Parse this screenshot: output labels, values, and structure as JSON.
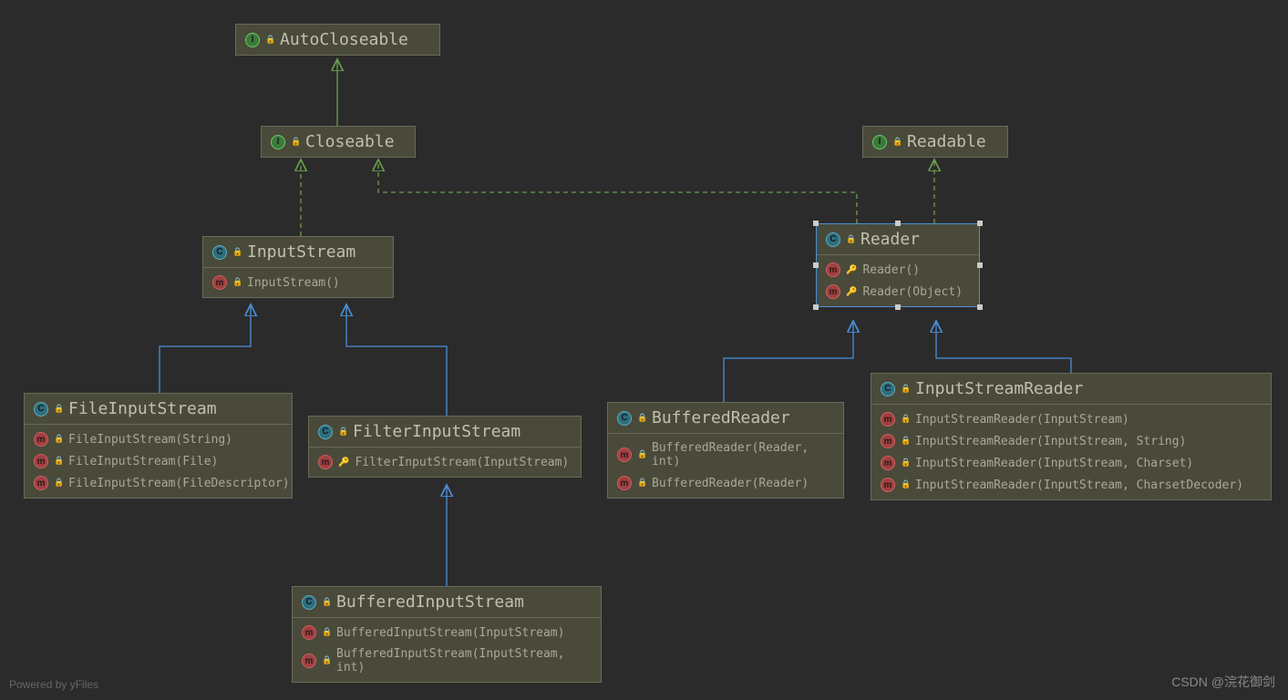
{
  "nodes": {
    "autoCloseable": {
      "type": "interface",
      "name": "AutoCloseable",
      "members": []
    },
    "closeable": {
      "type": "interface",
      "name": "Closeable",
      "members": []
    },
    "readable": {
      "type": "interface",
      "name": "Readable",
      "members": []
    },
    "inputStream": {
      "type": "class",
      "name": "InputStream",
      "members": [
        {
          "kind": "m",
          "vis": "lock",
          "sig": "InputStream()"
        }
      ]
    },
    "reader": {
      "type": "class",
      "name": "Reader",
      "selected": true,
      "members": [
        {
          "kind": "m",
          "vis": "key",
          "sig": "Reader()"
        },
        {
          "kind": "m",
          "vis": "key",
          "sig": "Reader(Object)"
        }
      ]
    },
    "fileInputStream": {
      "type": "class",
      "name": "FileInputStream",
      "members": [
        {
          "kind": "m",
          "vis": "lock",
          "sig": "FileInputStream(String)"
        },
        {
          "kind": "m",
          "vis": "lock",
          "sig": "FileInputStream(File)"
        },
        {
          "kind": "m",
          "vis": "lock",
          "sig": "FileInputStream(FileDescriptor)"
        }
      ]
    },
    "filterInputStream": {
      "type": "class",
      "name": "FilterInputStream",
      "members": [
        {
          "kind": "m",
          "vis": "key",
          "sig": "FilterInputStream(InputStream)"
        }
      ]
    },
    "bufferedReader": {
      "type": "class",
      "name": "BufferedReader",
      "members": [
        {
          "kind": "m",
          "vis": "lock",
          "sig": "BufferedReader(Reader, int)"
        },
        {
          "kind": "m",
          "vis": "lock",
          "sig": "BufferedReader(Reader)"
        }
      ]
    },
    "inputStreamReader": {
      "type": "class",
      "name": "InputStreamReader",
      "members": [
        {
          "kind": "m",
          "vis": "lock",
          "sig": "InputStreamReader(InputStream)"
        },
        {
          "kind": "m",
          "vis": "lock",
          "sig": "InputStreamReader(InputStream, String)"
        },
        {
          "kind": "m",
          "vis": "lock",
          "sig": "InputStreamReader(InputStream, Charset)"
        },
        {
          "kind": "m",
          "vis": "lock",
          "sig": "InputStreamReader(InputStream, CharsetDecoder)"
        }
      ]
    },
    "bufferedInputStream": {
      "type": "class",
      "name": "BufferedInputStream",
      "members": [
        {
          "kind": "m",
          "vis": "lock",
          "sig": "BufferedInputStream(InputStream)"
        },
        {
          "kind": "m",
          "vis": "lock",
          "sig": "BufferedInputStream(InputStream, int)"
        }
      ]
    }
  },
  "watermarks": {
    "left": "Powered by yFiles",
    "right": "CSDN @浣花御剑"
  },
  "edges_desc": [
    "Closeable --implements--> AutoCloseable (green solid)",
    "InputStream --implements--> Closeable (green dashed)",
    "Reader --implements--> Closeable (green dashed, routed)",
    "Reader --implements--> Readable (green dashed)",
    "FileInputStream --extends--> InputStream (blue solid)",
    "FilterInputStream --extends--> InputStream (blue solid)",
    "BufferedReader --extends--> Reader (blue solid)",
    "InputStreamReader --extends--> Reader (blue solid)",
    "BufferedInputStream --extends--> FilterInputStream (blue solid)"
  ]
}
